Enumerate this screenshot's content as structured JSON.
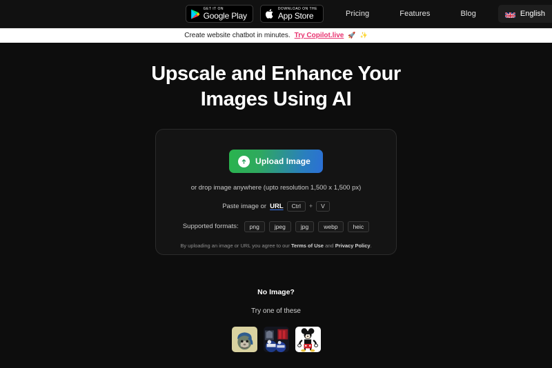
{
  "nav": {
    "google_play": {
      "top_label": "GET IT ON",
      "main_label": "Google Play",
      "icon": "google-play-icon"
    },
    "app_store": {
      "top_label": "Download on the",
      "main_label": "App Store",
      "icon": "apple-icon"
    },
    "links": [
      {
        "label": "Pricing"
      },
      {
        "label": "Features"
      },
      {
        "label": "Blog"
      }
    ],
    "language": {
      "label": "English",
      "icon": "uk-flag-icon"
    }
  },
  "promo": {
    "text": "Create website chatbot in minutes.",
    "link_label": "Try Copilot.live",
    "emoji_rocket": "🚀",
    "emoji_sparkle": "✨",
    "link_color": "#e8316f",
    "background": "#ffffff"
  },
  "hero": {
    "headline": "Upscale and Enhance Your Images Using AI"
  },
  "upload": {
    "button_label": "Upload Image",
    "button_icon": "upload-arrow-icon",
    "button_gradient_from": "#29b44e",
    "button_gradient_to": "#2b6fd6",
    "drop_text": "or drop image anywhere (upto resolution 1,500 x 1,500 px)",
    "paste_prefix": "Paste image or",
    "paste_link": "URL",
    "key_ctrl": "Ctrl",
    "key_plus": "+",
    "key_v": "V",
    "formats_label": "Supported formats:",
    "formats": [
      "png",
      "jpeg",
      "jpg",
      "webp",
      "heic"
    ],
    "legal_prefix": "By uploading an image or URL you agree to our",
    "legal_terms": "Terms of Use",
    "legal_and": "and",
    "legal_privacy": "Privacy Policy",
    "legal_suffix": "."
  },
  "samples": {
    "no_image_title": "No Image?",
    "try_label": "Try one of these",
    "items": [
      {
        "name": "bored-ape-thumbnail"
      },
      {
        "name": "comic-figures-thumbnail"
      },
      {
        "name": "mickey-mouse-thumbnail"
      }
    ]
  }
}
